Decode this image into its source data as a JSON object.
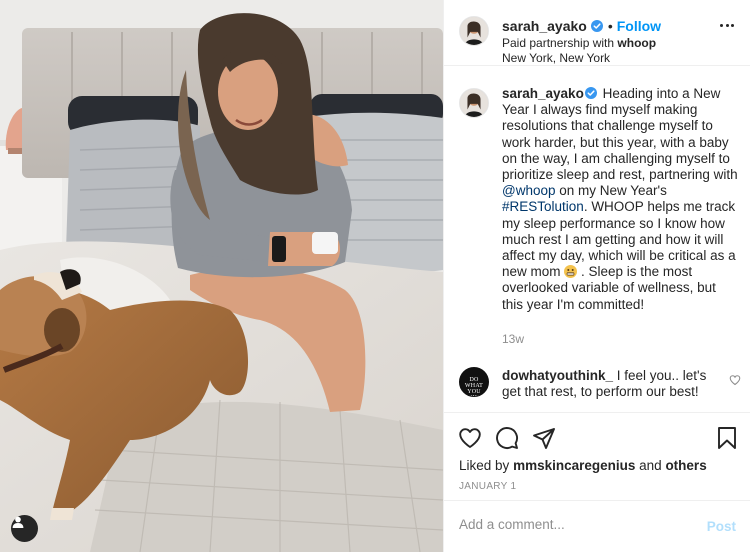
{
  "photo": {
    "alt_subject": "woman on bed with dog",
    "tag_icon": "user-tag-icon"
  },
  "header": {
    "username": "sarah_ayako",
    "verified_icon": "verified-badge-icon",
    "separator": "•",
    "follow_label": "Follow",
    "partnership_prefix": "Paid partnership with",
    "partner": "whoop",
    "location": "New York, New York",
    "more_icon": "more-options-icon"
  },
  "caption": {
    "username": "sarah_ayako",
    "text_1": " Heading into a New Year I always find myself making resolutions that challenge myself to work harder, but this year, with a baby on the way, I am challenging myself to prioritize sleep and rest, partnering with ",
    "mention": "@whoop",
    "text_2": " on my New Year's ",
    "hashtag": "#RESTolution",
    "text_3": ". WHOOP helps me track my sleep performance so I know how much rest I am getting and how it will affect my day, which will be critical as a new mom ",
    "emoji_icon": "grimacing-face-emoji",
    "text_4": " . Sleep is the most overlooked variable of wellness, but this year I'm committed!",
    "time": "13w"
  },
  "comment": {
    "avatar_text": "DO WHAT YOU THINK",
    "username": "dowhatyouthink_",
    "text": " I feel you.. let's get that rest, to perform our best!",
    "like_icon": "heart-outline-icon"
  },
  "actions": {
    "like_icon": "heart-icon",
    "comment_icon": "comment-icon",
    "share_icon": "share-icon",
    "save_icon": "bookmark-icon",
    "liked_prefix": "Liked by",
    "liked_user": "mmskincaregenius",
    "liked_and": "and",
    "liked_others": "others",
    "date": "JANUARY 1"
  },
  "add_comment": {
    "placeholder": "Add a comment...",
    "post_label": "Post"
  },
  "colors": {
    "link_blue": "#0095f6",
    "post_disabled": "#b2dffc",
    "text": "#262626",
    "muted": "#8e8e8e"
  }
}
